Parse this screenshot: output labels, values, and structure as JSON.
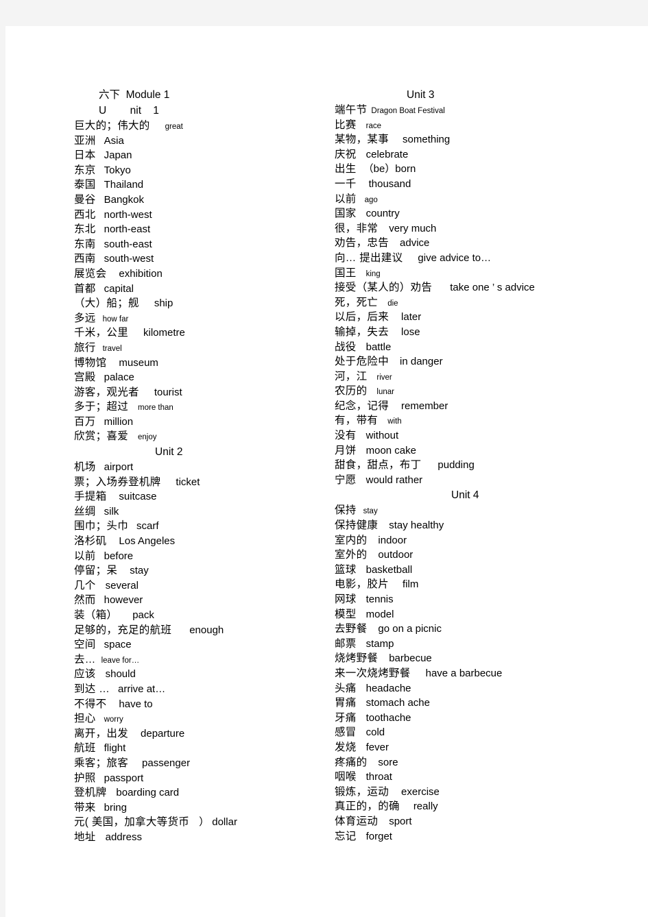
{
  "document": {
    "title_line": "六下  Module 1",
    "subtitle_line": "U        nit    1",
    "title_indent": 36,
    "subtitle_indent": 36
  },
  "left_column": {
    "header": {
      "module": "六下  Module 1",
      "unit": "U        nit    1"
    },
    "entries": [
      {
        "cn": "巨大的；伟大的",
        "en": "great",
        "gap": 22,
        "small": true
      },
      {
        "cn": "亚洲",
        "en": "Asia",
        "gap": 12,
        "small": false
      },
      {
        "cn": "日本",
        "en": "Japan",
        "gap": 12,
        "small": false
      },
      {
        "cn": "东京",
        "en": "Tokyo",
        "gap": 12,
        "small": false
      },
      {
        "cn": "泰国",
        "en": "Thailand",
        "gap": 12,
        "small": false
      },
      {
        "cn": "曼谷",
        "en": "Bangkok",
        "gap": 12,
        "small": false
      },
      {
        "cn": "西北",
        "en": "north-west",
        "gap": 12,
        "small": false
      },
      {
        "cn": "东北",
        "en": "north-east",
        "gap": 12,
        "small": false
      },
      {
        "cn": "东南",
        "en": "south-east",
        "gap": 12,
        "small": false
      },
      {
        "cn": "西南",
        "en": "south-west",
        "gap": 12,
        "small": false
      },
      {
        "cn": "展览会",
        "en": "exhibition",
        "gap": 18,
        "small": false
      },
      {
        "cn": "首都",
        "en": "capital",
        "gap": 12,
        "small": false
      },
      {
        "cn": "（大）船；舰",
        "en": "ship",
        "gap": 22,
        "small": false
      },
      {
        "cn": "多远",
        "en": "how far",
        "gap": 10,
        "small": true
      },
      {
        "cn": "千米，公里",
        "en": "kilometre",
        "gap": 22,
        "small": false
      },
      {
        "cn": "旅行",
        "en": "travel",
        "gap": 10,
        "small": true
      },
      {
        "cn": "博物馆",
        "en": "museum",
        "gap": 18,
        "small": false
      },
      {
        "cn": "宫殿",
        "en": "palace",
        "gap": 12,
        "small": false
      },
      {
        "cn": "游客，观光者",
        "en": "tourist",
        "gap": 22,
        "small": false
      },
      {
        "cn": "多于；超过",
        "en": "more than",
        "gap": 14,
        "small": true
      },
      {
        "cn": "百万",
        "en": "million",
        "gap": 12,
        "small": false
      },
      {
        "cn": "欣赏；喜爱",
        "en": "enjoy",
        "gap": 14,
        "small": true
      }
    ],
    "unit2": {
      "label": "Unit 2",
      "indent": 118
    },
    "entries2": [
      {
        "cn": "机场",
        "en": "airport",
        "gap": 12,
        "small": false
      },
      {
        "cn": "票；入场券登机牌",
        "en": "ticket",
        "gap": 22,
        "small": false
      },
      {
        "cn": "手提箱",
        "en": "suitcase",
        "gap": 18,
        "small": false
      },
      {
        "cn": "丝绸",
        "en": "silk",
        "gap": 12,
        "small": false
      },
      {
        "cn": "围巾；头巾",
        "en": "scarf",
        "gap": 12,
        "small": false
      },
      {
        "cn": "洛杉矶",
        "en": "Los Angeles",
        "gap": 18,
        "small": false
      },
      {
        "cn": "以前",
        "en": "before",
        "gap": 12,
        "small": false
      },
      {
        "cn": "停留；呆",
        "en": "stay",
        "gap": 18,
        "small": false
      },
      {
        "cn": "几个",
        "en": "several",
        "gap": 14,
        "small": false
      },
      {
        "cn": "然而",
        "en": "however",
        "gap": 12,
        "small": false
      },
      {
        "cn": "装（箱）",
        "en": "pack",
        "gap": 22,
        "small": false
      },
      {
        "cn": "足够的，充足的航班",
        "en": "enough",
        "gap": 26,
        "small": false
      },
      {
        "cn": "空间",
        "en": "space",
        "gap": 12,
        "small": false
      },
      {
        "cn": "去…",
        "en": "leave for…",
        "gap": 8,
        "small": true
      },
      {
        "cn": "应该",
        "en": "should",
        "gap": 14,
        "small": false
      },
      {
        "cn": "到达 …",
        "en": "arrive at…",
        "gap": 12,
        "small": false
      },
      {
        "cn": "不得不",
        "en": "have to",
        "gap": 18,
        "small": false
      },
      {
        "cn": "担心",
        "en": "worry",
        "gap": 12,
        "small": true
      },
      {
        "cn": "离开，出发",
        "en": "departure",
        "gap": 18,
        "small": false
      },
      {
        "cn": "航班",
        "en": "flight",
        "gap": 12,
        "small": false
      },
      {
        "cn": "乘客；旅客",
        "en": "passenger",
        "gap": 20,
        "small": false
      },
      {
        "cn": "护照",
        "en": "passport",
        "gap": 12,
        "small": false
      },
      {
        "cn": "登机牌",
        "en": "boarding card",
        "gap": 14,
        "small": false
      },
      {
        "cn": "带来",
        "en": "bring",
        "gap": 12,
        "small": false
      },
      {
        "cn": "元( 美国，加拿大等货币",
        "en": "） dollar",
        "gap": 14,
        "small": false
      },
      {
        "cn": "地址",
        "en": "address",
        "gap": 14,
        "small": false
      }
    ]
  },
  "right_column": {
    "unit3": {
      "label": "Unit 3",
      "indent": 105
    },
    "entries3": [
      {
        "cn": "端午节",
        "en": "Dragon Boat Festival",
        "gap": 6,
        "small": true
      },
      {
        "cn": "比赛",
        "en": "race",
        "gap": 14,
        "small": true
      },
      {
        "cn": "某物，某事",
        "en": "something",
        "gap": 20,
        "small": false
      },
      {
        "cn": "庆祝",
        "en": "celebrate",
        "gap": 14,
        "small": false
      },
      {
        "cn": "出生",
        "en": "（be）born",
        "gap": 10,
        "small": false
      },
      {
        "cn": "一千",
        "en": "thousand",
        "gap": 18,
        "small": false
      },
      {
        "cn": "以前",
        "en": "ago",
        "gap": 12,
        "small": true
      },
      {
        "cn": "国家",
        "en": "country",
        "gap": 14,
        "small": false
      },
      {
        "cn": "很，非常",
        "en": "very much",
        "gap": 16,
        "small": false
      },
      {
        "cn": "劝告，忠告",
        "en": "advice",
        "gap": 16,
        "small": false
      },
      {
        "cn": "向… 提出建议",
        "en": "give advice to…",
        "gap": 22,
        "small": false
      },
      {
        "cn": "国王",
        "en": "king",
        "gap": 14,
        "small": true
      },
      {
        "cn": "接受（某人的）劝告",
        "en": "take one ’ s advice",
        "gap": 26,
        "small": false
      },
      {
        "cn": "死，死亡",
        "en": "die",
        "gap": 14,
        "small": true
      },
      {
        "cn": "以后，后来",
        "en": "later",
        "gap": 18,
        "small": false
      },
      {
        "cn": "输掉，失去",
        "en": "lose",
        "gap": 18,
        "small": false
      },
      {
        "cn": "战役",
        "en": "battle",
        "gap": 14,
        "small": false
      },
      {
        "cn": "处于危险中",
        "en": "in danger",
        "gap": 16,
        "small": false
      },
      {
        "cn": "河，江",
        "en": "river",
        "gap": 14,
        "small": true
      },
      {
        "cn": "农历的",
        "en": "lunar",
        "gap": 14,
        "small": true
      },
      {
        "cn": "纪念，记得",
        "en": "remember",
        "gap": 18,
        "small": false
      },
      {
        "cn": "有，带有",
        "en": "with",
        "gap": 14,
        "small": true
      },
      {
        "cn": "没有",
        "en": "without",
        "gap": 14,
        "small": false
      },
      {
        "cn": "月饼",
        "en": "moon cake",
        "gap": 14,
        "small": false
      },
      {
        "cn": "甜食，甜点，布丁",
        "en": "pudding",
        "gap": 24,
        "small": false
      },
      {
        "cn": "宁愿",
        "en": "would rather",
        "gap": 14,
        "small": false
      }
    ],
    "unit4": {
      "label": "Unit 4",
      "indent": 170
    },
    "entries4": [
      {
        "cn": "保持",
        "en": "stay",
        "gap": 10,
        "small": true
      },
      {
        "cn": "保持健康",
        "en": "stay healthy",
        "gap": 16,
        "small": false
      },
      {
        "cn": "室内的",
        "en": "indoor",
        "gap": 16,
        "small": false
      },
      {
        "cn": "室外的",
        "en": "outdoor",
        "gap": 16,
        "small": false
      },
      {
        "cn": "篮球",
        "en": "basketball",
        "gap": 14,
        "small": false
      },
      {
        "cn": "电影，胶片",
        "en": "film",
        "gap": 20,
        "small": false
      },
      {
        "cn": "网球",
        "en": "tennis",
        "gap": 14,
        "small": false
      },
      {
        "cn": "模型",
        "en": "model",
        "gap": 14,
        "small": false
      },
      {
        "cn": "去野餐",
        "en": "go on a picnic",
        "gap": 16,
        "small": false
      },
      {
        "cn": "邮票",
        "en": "stamp",
        "gap": 14,
        "small": false
      },
      {
        "cn": "烧烤野餐",
        "en": "barbecue",
        "gap": 16,
        "small": false
      },
      {
        "cn": "来一次烧烤野餐",
        "en": "have a barbecue",
        "gap": 22,
        "small": false
      },
      {
        "cn": "头痛",
        "en": "headache",
        "gap": 14,
        "small": false
      },
      {
        "cn": "胃痛",
        "en": "stomach ache",
        "gap": 14,
        "small": false
      },
      {
        "cn": "牙痛",
        "en": "toothache",
        "gap": 14,
        "small": false
      },
      {
        "cn": "感冒",
        "en": "cold",
        "gap": 14,
        "small": false
      },
      {
        "cn": "发烧",
        "en": "fever",
        "gap": 14,
        "small": false
      },
      {
        "cn": "疼痛的",
        "en": "sore",
        "gap": 16,
        "small": false
      },
      {
        "cn": "咽喉",
        "en": "throat",
        "gap": 14,
        "small": false
      },
      {
        "cn": "锻炼，运动",
        "en": "exercise",
        "gap": 18,
        "small": false
      },
      {
        "cn": "真正的，的确",
        "en": "really",
        "gap": 20,
        "small": false
      },
      {
        "cn": "体育运动",
        "en": "sport",
        "gap": 16,
        "small": false
      },
      {
        "cn": "忘记",
        "en": "forget",
        "gap": 14,
        "small": false
      }
    ]
  }
}
